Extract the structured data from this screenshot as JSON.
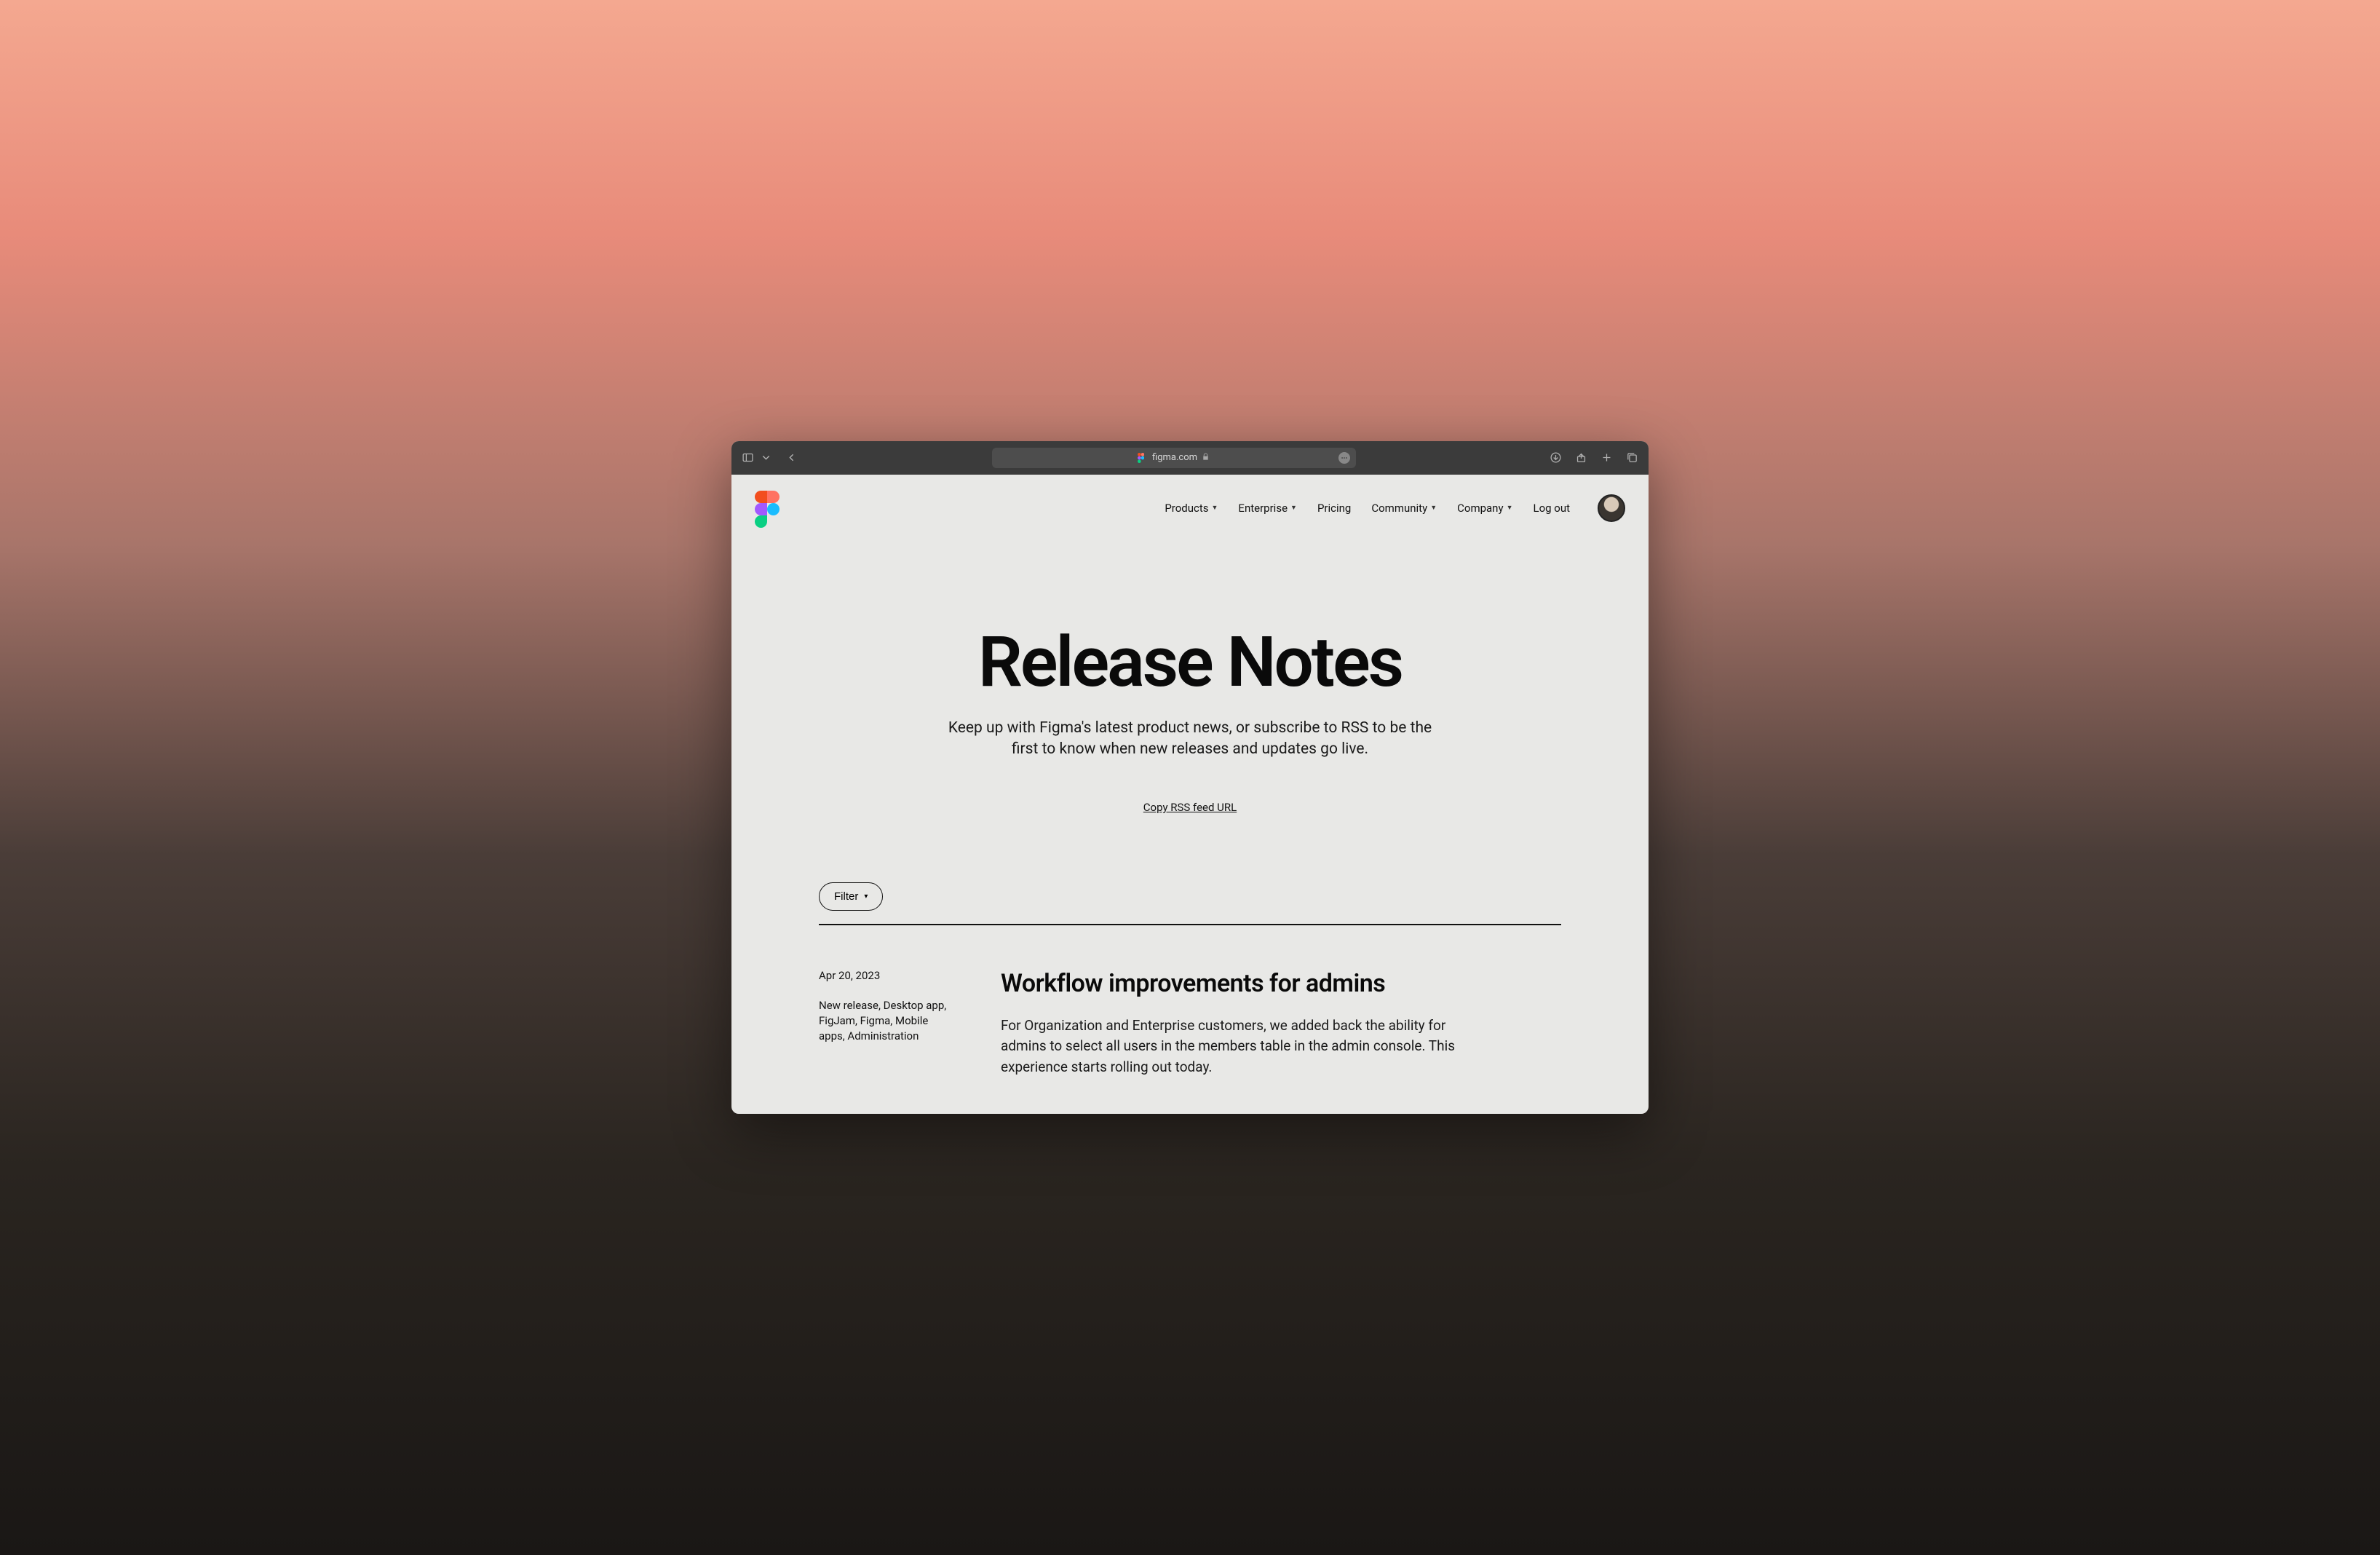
{
  "browser": {
    "domain": "figma.com"
  },
  "nav": {
    "items": [
      {
        "label": "Products",
        "dropdown": true
      },
      {
        "label": "Enterprise",
        "dropdown": true
      },
      {
        "label": "Pricing",
        "dropdown": false
      },
      {
        "label": "Community",
        "dropdown": true
      },
      {
        "label": "Company",
        "dropdown": true
      }
    ],
    "logout": "Log out"
  },
  "hero": {
    "title": "Release Notes",
    "subtitle": "Keep up with Figma's latest product news, or subscribe to RSS to be the first to know when new releases and updates go live.",
    "rss_label": "Copy RSS feed URL"
  },
  "filter": {
    "label": "Filter"
  },
  "entry": {
    "date": "Apr 20, 2023",
    "tags": "New release, Desktop app, FigJam, Figma, Mobile apps, Administration",
    "title": "Workflow improvements for admins",
    "body": "For Organization and Enterprise customers, we added back the ability for admins to select all users in the members table in the admin console. This experience starts rolling out today."
  }
}
